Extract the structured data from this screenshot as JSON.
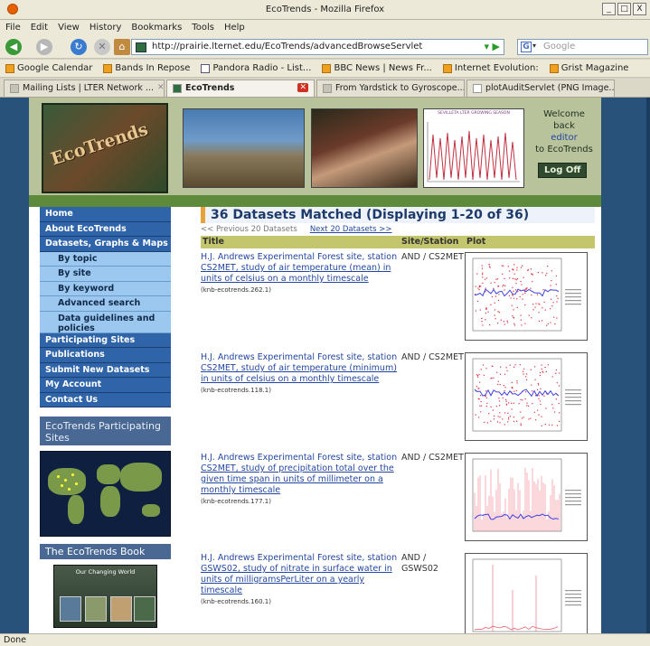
{
  "window": {
    "title": "EcoTrends - Mozilla Firefox",
    "controls": [
      "_",
      "□",
      "X"
    ]
  },
  "menubar": [
    "File",
    "Edit",
    "View",
    "History",
    "Bookmarks",
    "Tools",
    "Help"
  ],
  "toolbar": {
    "url": "http://prairie.lternet.edu/EcoTrends/advancedBrowseServlet",
    "search_placeholder": "Google",
    "search_engine_icon": "G"
  },
  "bookmarks": [
    "Google Calendar",
    "Bands In Repose",
    "Pandora Radio - List...",
    "BBC News | News Fr...",
    "Internet Evolution:",
    "Grist Magazine"
  ],
  "tabs": [
    {
      "label": "Mailing Lists | LTER Network ...",
      "active": false
    },
    {
      "label": "EcoTrends",
      "active": true
    },
    {
      "label": "From Yardstick to Gyroscope...",
      "active": false
    },
    {
      "label": "plotAuditServlet (PNG Image...",
      "active": false
    }
  ],
  "header": {
    "logo_text": "EcoTrends",
    "welcome_line1": "Welcome back",
    "welcome_user": "editor",
    "welcome_line2": "to EcoTrends",
    "logoff_label": "Log Off",
    "graph_title": "SEVILLETA LTER GROWING SEASON"
  },
  "nav": {
    "home": "Home",
    "about": "About EcoTrends",
    "datasets": "Datasets, Graphs & Maps",
    "by_topic": "By topic",
    "by_site": "By site",
    "by_keyword": "By keyword",
    "advanced": "Advanced search",
    "guidelines": "Data guidelines and policies",
    "participating": "Participating Sites",
    "publications": "Publications",
    "submit": "Submit New Datasets",
    "account": "My Account",
    "contact": "Contact Us"
  },
  "sidebar": {
    "sites_box": "EcoTrends Participating Sites",
    "book_box": "The EcoTrends Book",
    "book_title": "Our Changing World"
  },
  "results": {
    "heading": "36 Datasets Matched (Displaying 1-20 of 36)",
    "prev": "<< Previous 20 Datasets",
    "next": "Next 20 Datasets >>",
    "col_title": "Title",
    "col_site": "Site/Station",
    "col_plot": "Plot",
    "rows": [
      {
        "prefix": "H.J. Andrews Experimental Forest site, station",
        "link": "CS2MET, study of air temperature (mean) in units of celsius on a monthly timescale",
        "id": "(knb-ecotrends.262.1)",
        "site": "AND / CS2MET",
        "plot": "red-points"
      },
      {
        "prefix": "H.J. Andrews Experimental Forest site, station",
        "link": "CS2MET, study of air temperature (minimum) in units of celsius on a monthly timescale",
        "id": "(knb-ecotrends.118.1)",
        "site": "AND / CS2MET",
        "plot": "red-points"
      },
      {
        "prefix": "H.J. Andrews Experimental Forest site, station",
        "link": "CS2MET, study of precipitation total over the given time span in units of millimeter on a monthly timescale",
        "id": "(knb-ecotrends.177.1)",
        "site": "AND / CS2MET",
        "plot": "red-spikes"
      },
      {
        "prefix": "H.J. Andrews Experimental Forest site, station",
        "link": "GSWS02, study of nitrate in surface water in units of milligramsPerLiter on a yearly timescale",
        "id": "(knb-ecotrends.160.1)",
        "site": "AND / GSWS02",
        "plot": "sparse"
      }
    ]
  },
  "status": "Done",
  "colors": {
    "nav_blue": "#2f65a8",
    "nav_sub": "#9cc8f0",
    "header_green": "#b8c39c",
    "table_head": "#c4c66e",
    "link": "#2347a0"
  }
}
